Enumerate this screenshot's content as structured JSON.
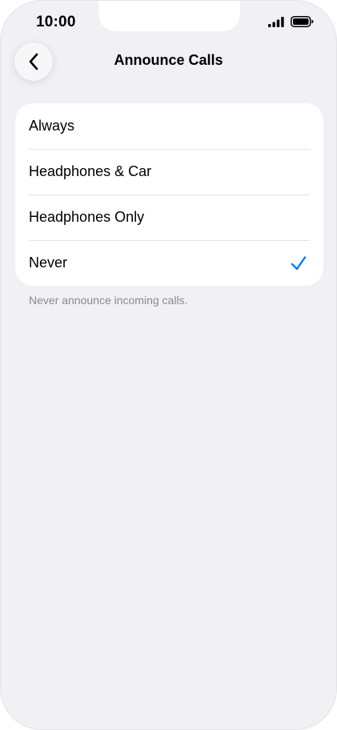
{
  "status_bar": {
    "time": "10:00",
    "icons": [
      "cellular-signal-icon",
      "battery-icon"
    ]
  },
  "nav": {
    "back_icon": "chevron-left-icon",
    "title": "Announce Calls"
  },
  "options": [
    {
      "label": "Always",
      "selected": false
    },
    {
      "label": "Headphones & Car",
      "selected": false
    },
    {
      "label": "Headphones Only",
      "selected": false
    },
    {
      "label": "Never",
      "selected": true
    }
  ],
  "footer_note": "Never announce incoming calls.",
  "colors": {
    "background": "#f0f0f5",
    "accent": "#007aff",
    "secondary_text": "#8a8a8e"
  }
}
